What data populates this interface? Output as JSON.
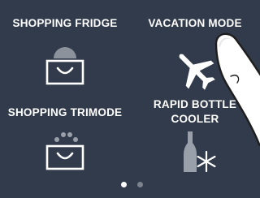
{
  "tiles": [
    {
      "label": "SHOPPING FRIDGE",
      "icon": "shopping-fridge-icon"
    },
    {
      "label": "VACATION MODE",
      "icon": "airplane-icon"
    },
    {
      "label": "SHOPPING TRIMODE",
      "icon": "shopping-trimode-icon"
    },
    {
      "label_line1": "RAPID BOTTLE",
      "label_line2": "COOLER",
      "icon": "rapid-bottle-cooler-icon"
    }
  ],
  "pager": {
    "pages": 2,
    "active": 1
  },
  "colors": {
    "background": "#323b4b",
    "text": "#ffffff",
    "icon_white": "#ffffff",
    "icon_grey": "#9aa0aa",
    "dot_active": "#ffffff",
    "dot_inactive": "#7d838e"
  }
}
